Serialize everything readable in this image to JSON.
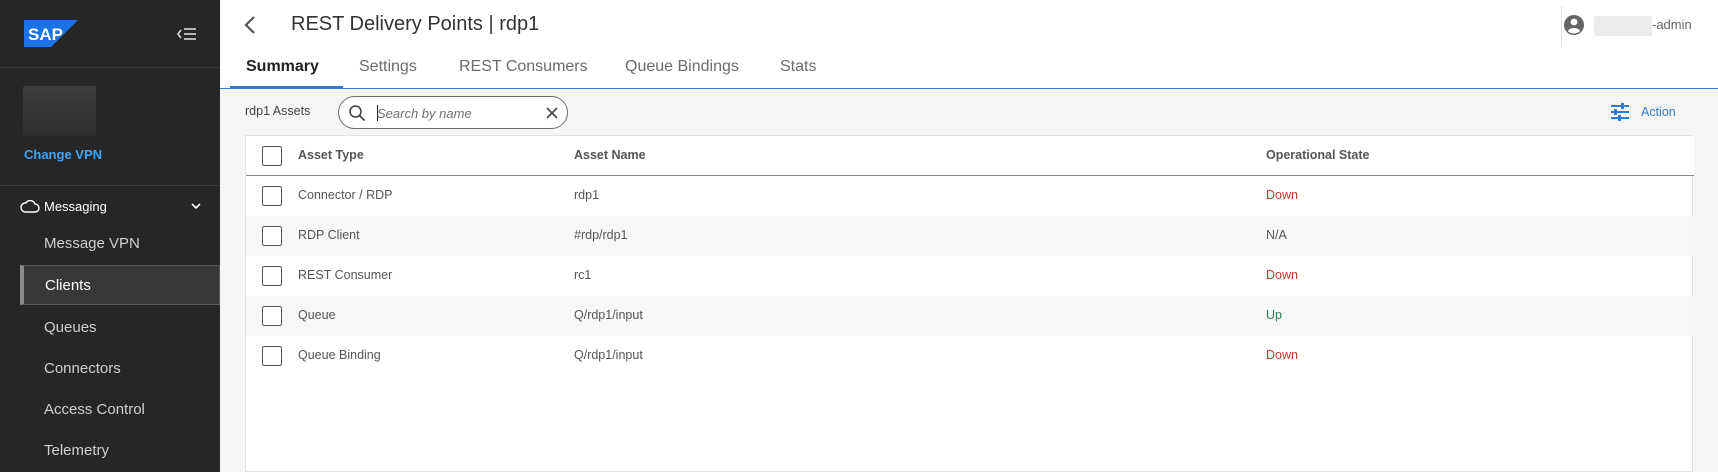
{
  "brand": {
    "logo_text": "SAP",
    "logo_color": "#1a73e8"
  },
  "sidebar": {
    "change_vpn_label": "Change VPN",
    "section": {
      "label": "Messaging",
      "icon": "cloud-icon",
      "expanded": true
    },
    "items": [
      {
        "label": "Message VPN",
        "active": false
      },
      {
        "label": "Clients",
        "active": true
      },
      {
        "label": "Queues",
        "active": false
      },
      {
        "label": "Connectors",
        "active": false
      },
      {
        "label": "Access Control",
        "active": false
      },
      {
        "label": "Telemetry",
        "active": false
      }
    ]
  },
  "header": {
    "title": "REST Delivery Points | rdp1",
    "user_suffix": "-admin"
  },
  "tabs": [
    {
      "label": "Summary",
      "active": true
    },
    {
      "label": "Settings",
      "active": false
    },
    {
      "label": "REST Consumers",
      "active": false
    },
    {
      "label": "Queue Bindings",
      "active": false
    },
    {
      "label": "Stats",
      "active": false
    }
  ],
  "toolbar": {
    "assets_label": "rdp1 Assets",
    "search_placeholder": "Search by name",
    "action_label": "Action"
  },
  "table": {
    "columns": [
      "Asset Type",
      "Asset Name",
      "Operational State"
    ],
    "rows": [
      {
        "type": "Connector / RDP",
        "name": "rdp1",
        "state": "Down"
      },
      {
        "type": "RDP Client",
        "name": "#rdp/rdp1",
        "state": "N/A"
      },
      {
        "type": "REST Consumer",
        "name": "rc1",
        "state": "Down"
      },
      {
        "type": "Queue",
        "name": "Q/rdp1/input",
        "state": "Up"
      },
      {
        "type": "Queue Binding",
        "name": "Q/rdp1/input",
        "state": "Down"
      }
    ]
  },
  "colors": {
    "accent": "#2e7bcf",
    "down": "#c0392b",
    "up": "#2e7d4f",
    "sidebar_bg": "#262626"
  }
}
